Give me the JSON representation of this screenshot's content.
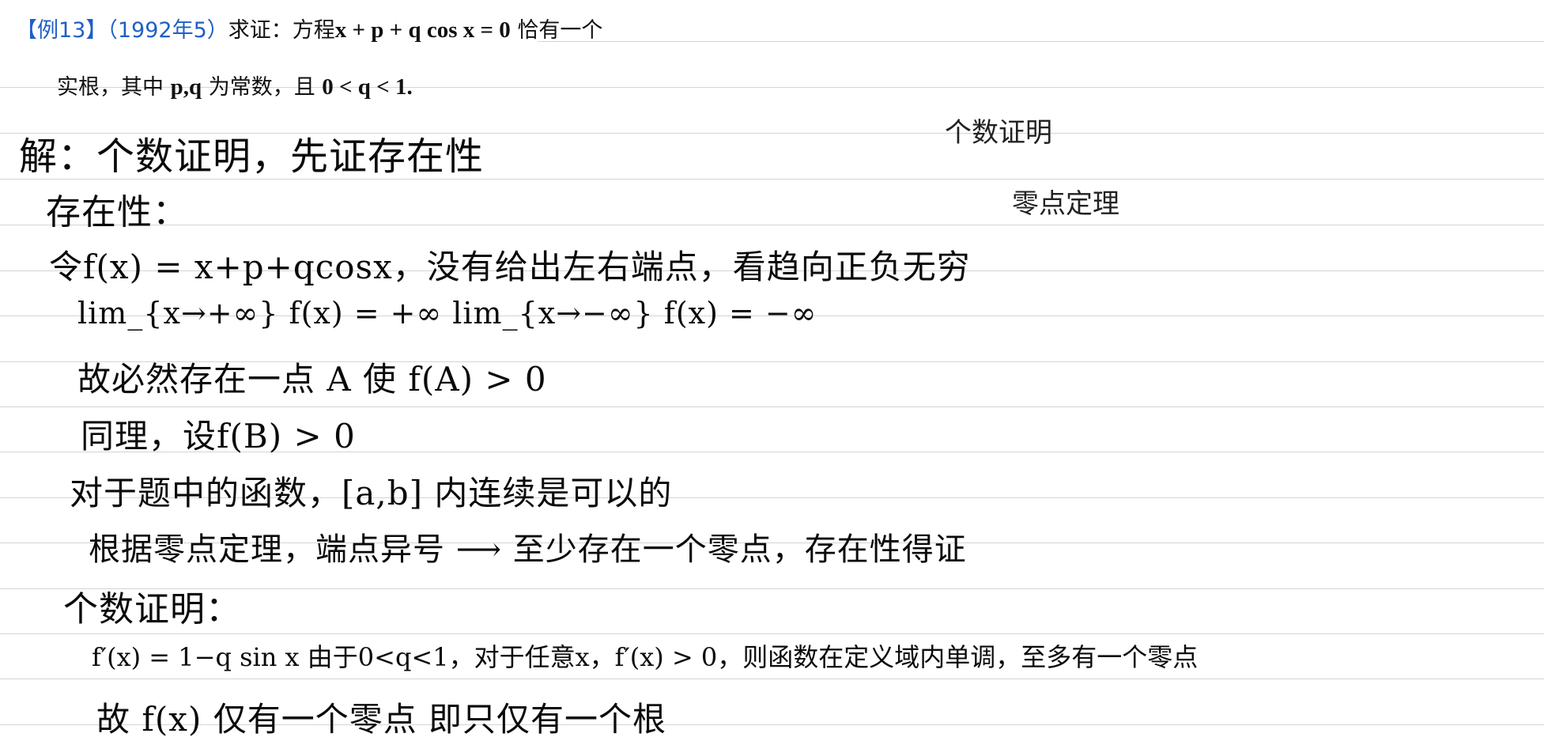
{
  "problem": {
    "tag": "【例13】",
    "source": "（1992年5）",
    "stmt_a": "求证：方程",
    "equation": "x + p + q cos x = 0",
    "stmt_b": " 恰有一个",
    "line2_a": "实根，其中 ",
    "params": "p,q",
    "line2_b": " 为常数，且 ",
    "condition": "0 < q < 1."
  },
  "notes": {
    "count_proof": "个数证明",
    "zero_theorem": "零点定理"
  },
  "handwriting": [
    "解：个数证明，先证存在性",
    "存在性：",
    "令f(x) = x+p+qcosx，没有给出左右端点，看趋向正负无穷",
    "lim_{x→+∞} f(x) = +∞        lim_{x→−∞} f(x) = −∞",
    "故必然存在一点 A  使 f(A) > 0",
    "同理，设f(B) > 0",
    "对于题中的函数，[a,b] 内连续是可以的",
    "根据零点定理，端点异号 ⟶ 至少存在一个零点，存在性得证",
    "个数证明：",
    "f′(x) = 1−q sin x   由于0<q<1，对于任意x，f′(x) > 0，则函数在定义域内单调，至多有一个零点",
    "故 f(x) 仅有一个零点  即只仅有一个根"
  ]
}
